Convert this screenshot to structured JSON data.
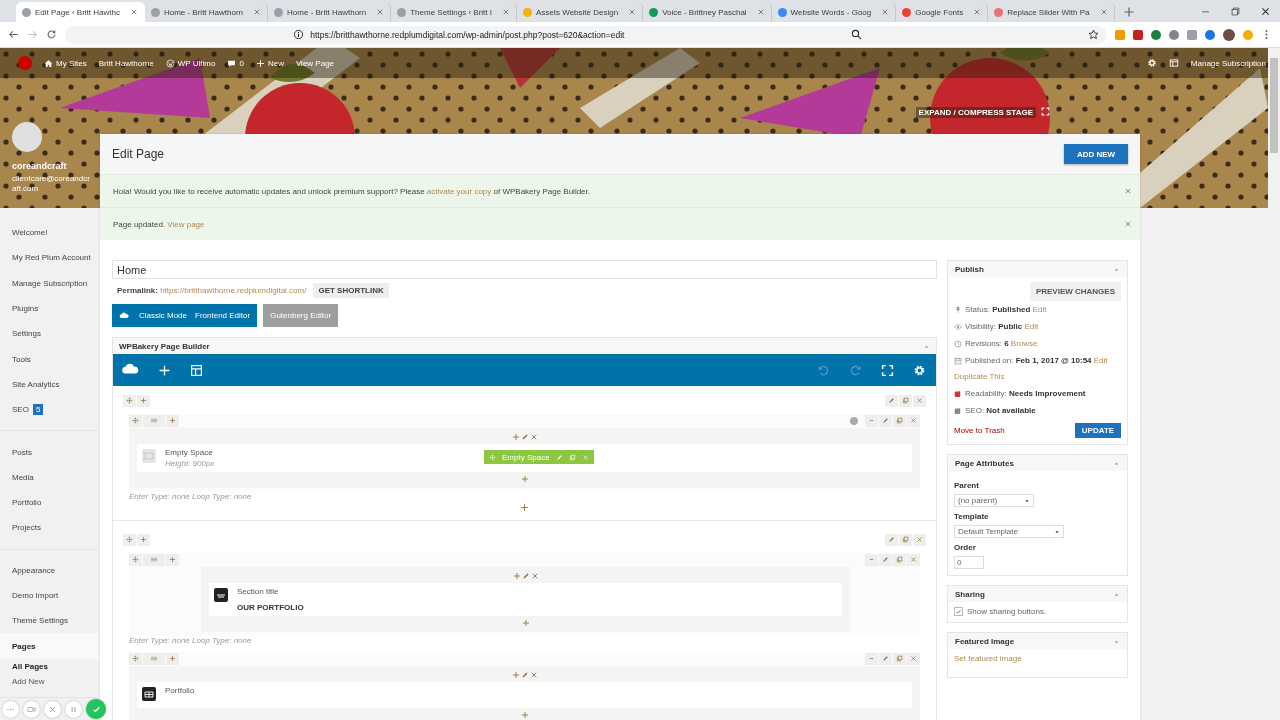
{
  "browser": {
    "tabs": [
      {
        "title": "Edit Page ‹ Britt Hawthc",
        "selected": true,
        "color": "#9aa0a6"
      },
      {
        "title": "Home - Britt Hawthorn",
        "selected": false,
        "color": "#9aa0a6"
      },
      {
        "title": "Home - Britt Hawthorn",
        "selected": false,
        "color": "#9aa0a6"
      },
      {
        "title": "Theme Settings ‹ Britt I",
        "selected": false,
        "color": "#9aa0a6"
      },
      {
        "title": "Assets Website Design",
        "selected": false,
        "color": "#f4b400"
      },
      {
        "title": "Voice - Brittney Paschal",
        "selected": false,
        "color": "#0f9d58"
      },
      {
        "title": "Website Words - Goog",
        "selected": false,
        "color": "#4285f4"
      },
      {
        "title": "Google Fonts",
        "selected": false,
        "color": "#ea4335"
      },
      {
        "title": "Replace Slider With Pa",
        "selected": false,
        "color": "#e57373"
      }
    ],
    "url": "https://britthawthorne.redplumdigital.com/wp-admin/post.php?post=620&action=edit"
  },
  "admin_bar": {
    "items": [
      {
        "kind": "sites",
        "label": "My Sites"
      },
      {
        "kind": "site",
        "label": "Britt Hawthorne"
      },
      {
        "kind": "ultimo",
        "label": "WP Ultimo"
      },
      {
        "kind": "comments",
        "label": "0"
      },
      {
        "kind": "new",
        "label": "New"
      },
      {
        "kind": "view",
        "label": "View Page"
      }
    ],
    "account": "Manage Subscription"
  },
  "stage_toggle": "EXPAND / COMPRESS STAGE",
  "profile": {
    "name": "coreandcraft",
    "email": "clientcare@coreandcraft.com"
  },
  "sidebar": {
    "groups": [
      {
        "items": [
          {
            "label": "Welcome!",
            "selected": false
          },
          {
            "label": "My Red Plum Account",
            "selected": false
          },
          {
            "label": "Manage Subscription",
            "selected": false
          },
          {
            "label": "Plugins",
            "selected": false
          },
          {
            "label": "Settings",
            "selected": false
          },
          {
            "label": "Tools",
            "selected": false
          },
          {
            "label": "Site Analytics",
            "selected": false
          },
          {
            "label": "SEO",
            "selected": false,
            "badge": "5"
          }
        ]
      },
      {
        "items": [
          {
            "label": "Posts",
            "selected": false
          },
          {
            "label": "Media",
            "selected": false
          },
          {
            "label": "Portfolio",
            "selected": false
          },
          {
            "label": "Projects",
            "selected": false
          }
        ]
      },
      {
        "items": [
          {
            "label": "Appearance",
            "selected": false
          },
          {
            "label": "Demo Import",
            "selected": false
          },
          {
            "label": "Theme Settings",
            "selected": false
          },
          {
            "label": "Pages",
            "selected": true,
            "children": [
              {
                "label": "All Pages",
                "selected": true
              },
              {
                "label": "Add New",
                "selected": false
              }
            ]
          }
        ]
      }
    ]
  },
  "header": {
    "title": "Edit Page",
    "add_new": "ADD NEW"
  },
  "notices": [
    {
      "before": "Hola! Would you like to receive automatic updates and unlock premium support? Please ",
      "link": "activate your copy",
      "after": " of WPBakery Page Builder."
    },
    {
      "before": "Page updated. ",
      "link": "View page"
    }
  ],
  "editor": {
    "title": "Home",
    "permalink_label": "Permalink:",
    "permalink": "https://britthawthorne.redplumdigital.com/",
    "shortlink": "GET SHORTLINK",
    "modes": [
      {
        "label": "Classic Mode",
        "disabled": false
      },
      {
        "label": "Frontend Editor",
        "disabled": false
      },
      {
        "label": "Gutenberg Editor",
        "disabled": true
      }
    ]
  },
  "builder": {
    "title": "WPBakery Page Builder",
    "tools": [
      {
        "kind": "logo",
        "disabled": false
      },
      {
        "kind": "add",
        "disabled": false
      },
      {
        "kind": "layout",
        "disabled": false
      },
      {
        "kind": "undo",
        "disabled": true
      },
      {
        "kind": "redo",
        "disabled": true
      },
      {
        "kind": "fullscreen",
        "disabled": false
      },
      {
        "kind": "settings",
        "disabled": false
      }
    ],
    "rows": [
      {
        "add_row": true,
        "inner_rows": [
          {
            "status_dot": true,
            "centered": false,
            "elements": [
              {
                "kind": "empty-space",
                "title": "Empty Space",
                "subtitle": "Height: 900px",
                "hover_label": "Empty Space"
              }
            ],
            "footer": "Enter Type: none Loop Type: none"
          }
        ]
      },
      {
        "add_row": false,
        "inner_rows": [
          {
            "status_dot": false,
            "centered": true,
            "elements": [
              {
                "kind": "section-title",
                "title": "Section title",
                "content": "OUR PORTFOLIO"
              }
            ],
            "footer": "Enter Type: none Loop Type: none"
          },
          {
            "status_dot": false,
            "centered": false,
            "elements": [
              {
                "kind": "portfolio",
                "title": "Portfolio"
              }
            ]
          }
        ]
      }
    ]
  },
  "publish": {
    "title": "Publish",
    "preview": "PREVIEW CHANGES",
    "meta": [
      {
        "kind": "status",
        "label": "Status: ",
        "value": "Published",
        "link": "Edit"
      },
      {
        "kind": "visibility",
        "label": "Visibility: ",
        "value": "Public",
        "link": "Edit"
      },
      {
        "kind": "revisions",
        "label": "Revisions: ",
        "value": "6",
        "link": "Browse"
      },
      {
        "kind": "date",
        "label": "Published on: ",
        "value": "Feb 1, 2017 @ 10:54",
        "link": "Edit"
      }
    ],
    "duplicate": "Duplicate This",
    "seo": [
      {
        "label": "Readability: ",
        "value": "Needs Improvement",
        "color": "#dc3232"
      },
      {
        "label": "SEO: ",
        "value": "Not available",
        "color": "#888888"
      }
    ],
    "trash": "Move to Trash",
    "update": "UPDATE"
  },
  "page_attributes": {
    "title": "Page Attributes",
    "parent_label": "Parent",
    "parent_value": "(no parent)",
    "template_label": "Template",
    "template_value": "Default Template",
    "order_label": "Order",
    "order_value": "0"
  },
  "sharing": {
    "title": "Sharing",
    "label": "Show sharing buttons.",
    "checked": true
  },
  "featured_image": {
    "title": "Featured Image",
    "link": "Set featured image"
  }
}
